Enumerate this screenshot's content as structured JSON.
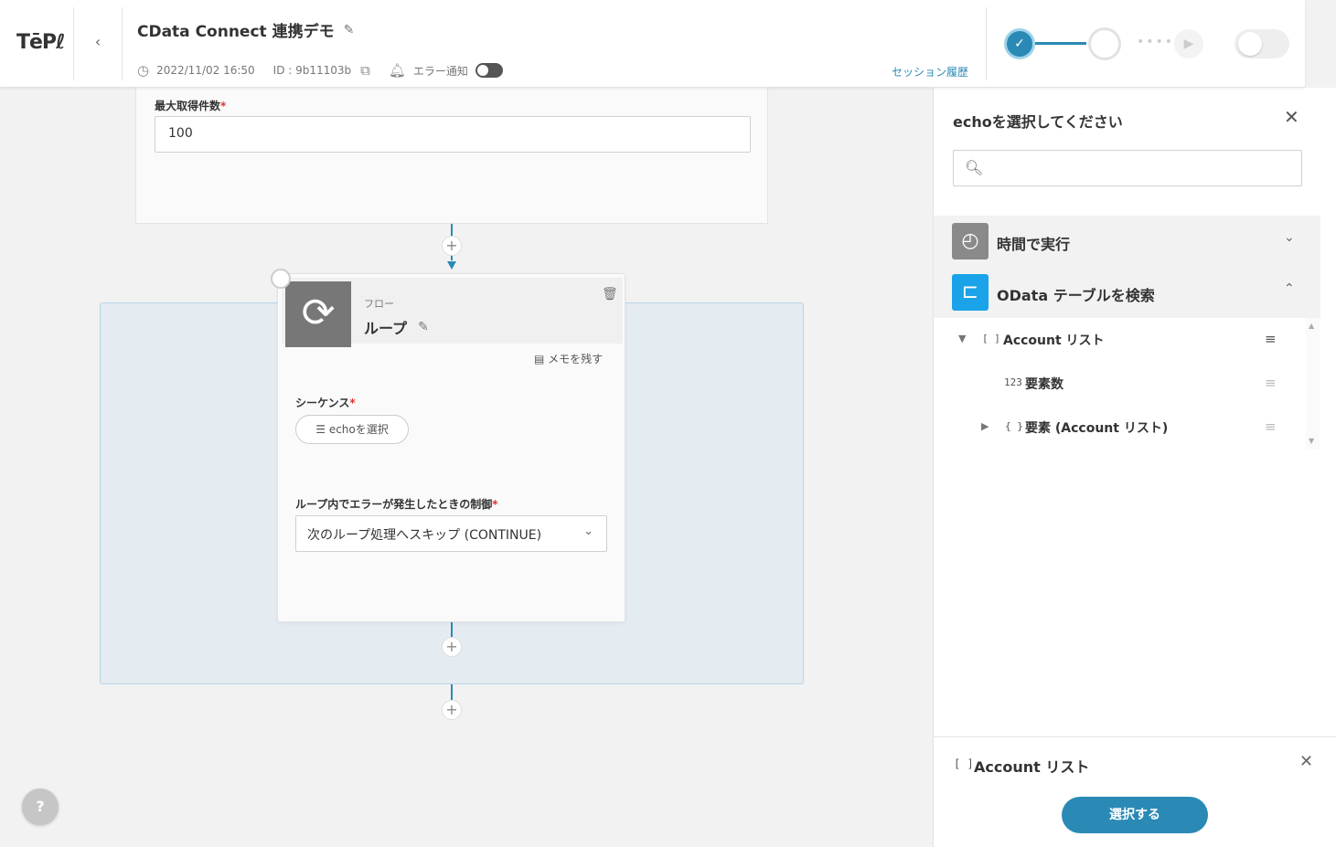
{
  "header": {
    "logo": "TēPℓ",
    "title": "CData Connect 連携デモ",
    "datetime": "2022/11/02 16:50",
    "id_text": "ID : 9b11103b",
    "error_notify_label": "エラー通知",
    "session_history": "セッション履歴"
  },
  "card1": {
    "field_label": "最大取得件数",
    "field_value": "100"
  },
  "loop": {
    "kind": "フロー",
    "name": "ループ",
    "memo": "メモを残す",
    "sequence_label": "シーケンス",
    "echo_button": "echoを選択",
    "error_control_label": "ループ内でエラーが発生したときの制御",
    "error_control_value": "次のループ処理へスキップ (CONTINUE)"
  },
  "help": "?",
  "panel": {
    "title": "echoを選択してください",
    "search_placeholder": "",
    "categories": [
      {
        "name": "時間で実行",
        "color": "#8a8a8a",
        "icon": "clock-icon"
      },
      {
        "name": "OData テーブルを検索",
        "color": "#1aa3e8",
        "icon": "odata-icon"
      }
    ],
    "tree": [
      {
        "type": "[ ]",
        "label": "Account リスト"
      },
      {
        "type": "123",
        "label": "要素数"
      },
      {
        "type": "{ }",
        "label": "要素 (Account リスト)"
      }
    ],
    "selected": {
      "type": "[ ]",
      "label": "Account リスト"
    },
    "select_button": "選択する"
  },
  "colors": {
    "accent": "#2a8ab5",
    "loop_bg": "#e4ebf1",
    "odata": "#1aa3e8"
  }
}
